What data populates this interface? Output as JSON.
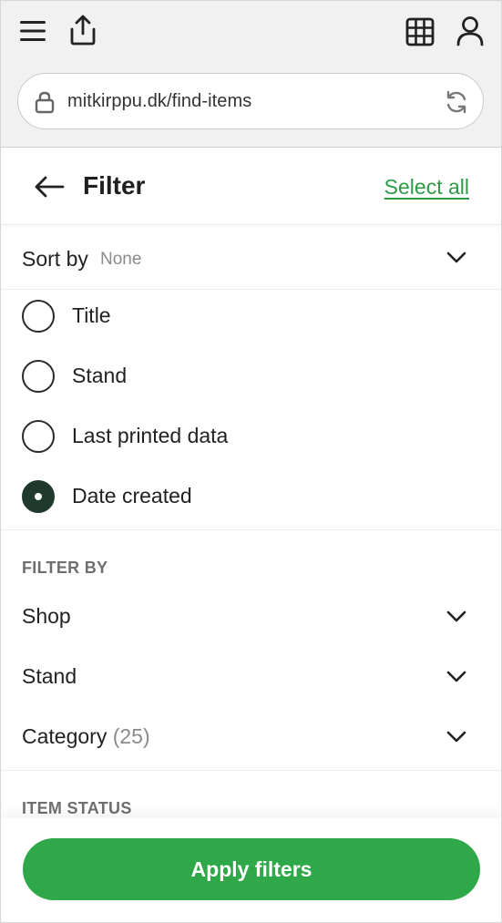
{
  "browser": {
    "url": "mitkirppu.dk/find-items",
    "icons": [
      "menu-icon",
      "share-icon",
      "grid-icon",
      "user-icon",
      "lock-icon",
      "reload-icon"
    ]
  },
  "header": {
    "title": "Filter",
    "select_all_label": "Select all",
    "back_icon": "arrow-left-icon"
  },
  "sort": {
    "label": "Sort by",
    "value": "None",
    "options": [
      {
        "label": "Title",
        "checked": false
      },
      {
        "label": "Stand",
        "checked": false
      },
      {
        "label": "Last printed data",
        "checked": false
      },
      {
        "label": "Date created",
        "checked": true
      }
    ]
  },
  "filter_by": {
    "title": "FILTER BY",
    "items": [
      {
        "label": "Shop",
        "count": ""
      },
      {
        "label": "Stand",
        "count": ""
      },
      {
        "label": "Category",
        "count": "(25)"
      }
    ]
  },
  "item_status": {
    "title": "ITEM STATUS"
  },
  "footer": {
    "apply_label": "Apply filters"
  },
  "colors": {
    "accent": "#2fa84a",
    "link": "#2e9b46",
    "radio_checked": "#1f3a2c"
  }
}
